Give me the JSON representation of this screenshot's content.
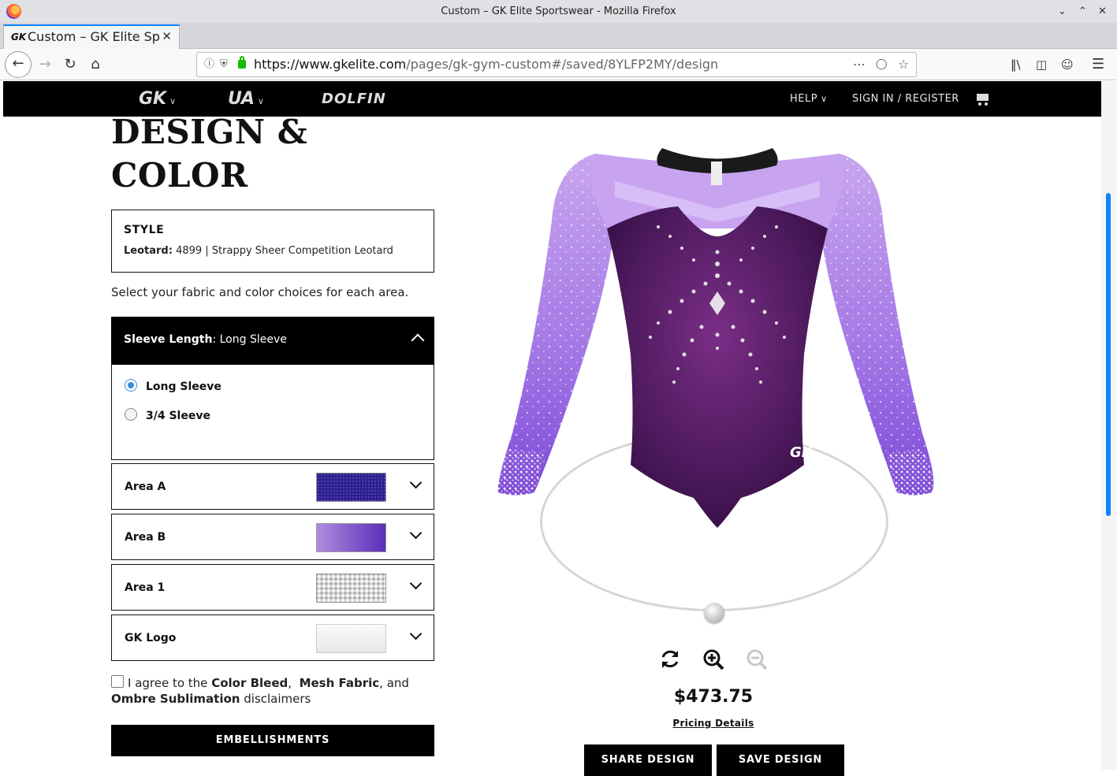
{
  "window": {
    "title": "Custom – GK Elite Sportswear - Mozilla Firefox"
  },
  "tab": {
    "label": "Custom – GK Elite Sportswear",
    "logo": "GK"
  },
  "urlbar": {
    "url_domain": "https://www.gkelite.com",
    "url_path": "/pages/gk-gym-custom#/saved/8YLFP2MY/design"
  },
  "site_nav": {
    "brands": [
      "GK",
      "UA",
      "DOLFIN"
    ],
    "help": "HELP",
    "signin": "SIGN IN / REGISTER"
  },
  "page": {
    "heading_line1": "DESIGN &",
    "heading_line2": "COLOR",
    "style_label": "STYLE",
    "style_key": "Leotard:",
    "style_value": "4899 | Strappy Sheer Competition Leotard",
    "instructions": "Select your fabric and color choices for each area."
  },
  "sleeve": {
    "label": "Sleeve Length",
    "selected": "Long Sleeve",
    "options": [
      "Long Sleeve",
      "3/4 Sleeve"
    ]
  },
  "areas": [
    {
      "name": "Area A"
    },
    {
      "name": "Area B"
    },
    {
      "name": "Area 1"
    },
    {
      "name": "GK Logo"
    }
  ],
  "agree": {
    "prefix": "I agree to the",
    "term1": "Color Bleed",
    "term2": "Mesh Fabric",
    "and": "and",
    "term3": "Ombre Sublimation",
    "suffix": "disclaimers"
  },
  "buttons": {
    "embellishments": "EMBELLISHMENTS",
    "share": "SHARE DESIGN",
    "save": "SAVE DESIGN"
  },
  "viewer": {
    "logo_text": "GK"
  },
  "price": {
    "amount": "$473.75",
    "details": "Pricing Details"
  },
  "colors": {
    "accent": "#0a84ff",
    "area_a": "#3b2a9e",
    "area_b": "#7a4fd0",
    "leotard_body": "#4a1a5a"
  }
}
